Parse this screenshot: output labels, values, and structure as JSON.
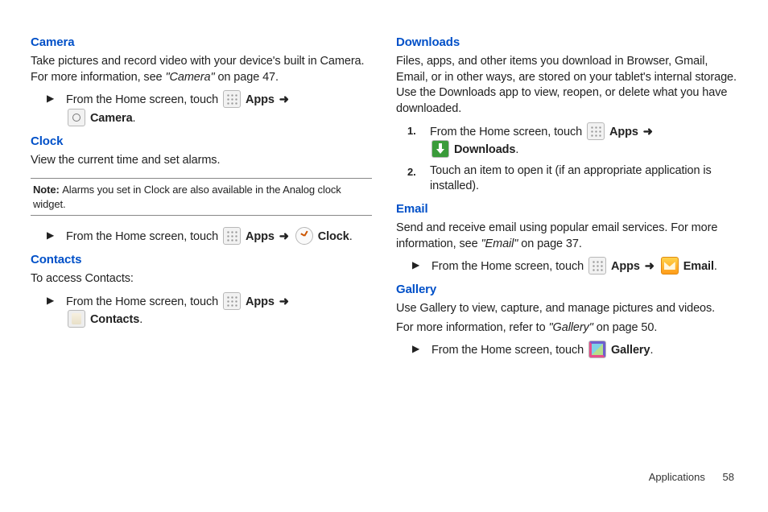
{
  "left": {
    "camera": {
      "heading": "Camera",
      "intro_a": "Take pictures and record video with your device's built in Camera. For more information, see ",
      "intro_ref": "\"Camera\"",
      "intro_b": " on page 47.",
      "step_pre": "From the Home screen, touch ",
      "apps": "Apps",
      "camera_label": "Camera"
    },
    "clock": {
      "heading": "Clock",
      "intro": "View the current time and set alarms.",
      "note_label": "Note: ",
      "note_text": "Alarms you set in Clock are also available in the Analog clock widget.",
      "step_pre": "From the Home screen, touch ",
      "apps": "Apps",
      "clock_label": "Clock"
    },
    "contacts": {
      "heading": "Contacts",
      "intro": "To access Contacts:",
      "step_pre": "From the Home screen, touch ",
      "apps": "Apps",
      "contacts_label": "Contacts"
    }
  },
  "right": {
    "downloads": {
      "heading": "Downloads",
      "intro": "Files, apps, and other items you download in Browser, Gmail, Email, or in other ways, are stored on your tablet's internal storage. Use the Downloads app to view, reopen, or delete what you have downloaded.",
      "num1": "1.",
      "step1_pre": "From the Home screen, touch ",
      "apps": "Apps",
      "downloads_label": "Downloads",
      "num2": "2.",
      "step2": "Touch an item to open it (if an appropriate application is installed)."
    },
    "email": {
      "heading": "Email",
      "intro_a": "Send and receive email using popular email services. For more information, see ",
      "intro_ref": "\"Email\"",
      "intro_b": " on page 37.",
      "step_pre": "From the Home screen, touch ",
      "apps": "Apps",
      "email_label": "Email"
    },
    "gallery": {
      "heading": "Gallery",
      "intro": "Use Gallery to view, capture, and manage pictures and videos.",
      "more_a": "For more information, refer to ",
      "more_ref": "\"Gallery\" ",
      "more_b": " on page 50.",
      "step_pre": "From the Home screen, touch ",
      "gallery_label": "Gallery"
    }
  },
  "footer": {
    "section": "Applications",
    "page": "58"
  },
  "symbols": {
    "bullet": "▶",
    "arrow": "➜",
    "period": "."
  }
}
